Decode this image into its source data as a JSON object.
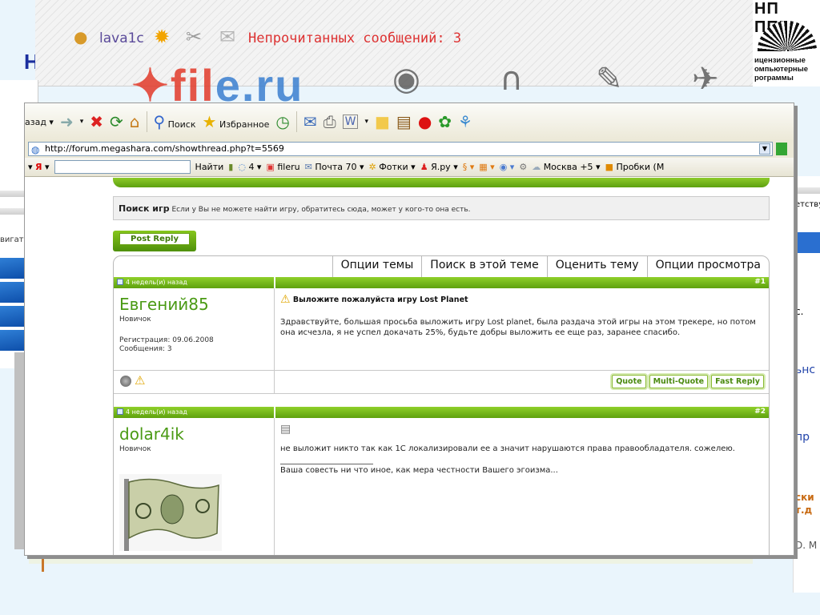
{
  "background": {
    "letter": "Н",
    "user_name": "lava1c",
    "unread_text": "Непрочитанных сообщений: 3",
    "right_logo": {
      "top_text": "НП ППП",
      "lines": [
        "ицензионные",
        "омпьютерные",
        "рограммы"
      ]
    },
    "left_strip_label": "вигато",
    "right_panel": [
      "етству",
      "с.",
      "ьнс",
      "пр",
      "ски",
      "т.д",
      "D. M"
    ]
  },
  "browser": {
    "toolbar": {
      "back_label": "азад",
      "search_label": "Поиск",
      "favorites_label": "Избранное"
    },
    "address": "http://forum.megashara.com/showthread.php?t=5569",
    "yandex_bar": {
      "logo": "Я",
      "find_label": "Найти",
      "messages": "4",
      "items": [
        "fileru",
        "Почта 70",
        "Фотки",
        "Я.ру",
        "Москва +5",
        "Пробки (М"
      ]
    }
  },
  "forum": {
    "info_title": "Поиск игр",
    "info_text": "Если у Вы не можете найти игру, обратитесь сюда, может у кого-то она есть.",
    "post_reply_label": "Post Reply",
    "thread_tools": [
      "Опции темы",
      "Поиск в этой теме",
      "Оценить тему",
      "Опции просмотра"
    ],
    "posts": [
      {
        "date": "4 недель(и) назад",
        "number": "#1",
        "user": "Евгений85",
        "user_title": "Новичок",
        "registered": "Регистрация: 09.06.2008",
        "messages": "Сообщения: 3",
        "title": "Выложите пожалуйста игру Lost Planet",
        "text": "Здравствуйте, большая просьба выложить игру Lost planet, была раздача этой игры на этом трекере, но потом она исчезла, я не успел докачать 25%, будьте добры выложить ее еще раз, заранее спасибо.",
        "buttons": [
          "Quote",
          "Multi-Quote",
          "Fast Reply"
        ]
      },
      {
        "date": "4 недель(и) назад",
        "number": "#2",
        "user": "dolar4ik",
        "user_title": "Новичок",
        "text": "не выложит никто так как 1С локализировали ее а значит нарушаются права правообладателя. сожелею.",
        "signature": "Ваша совесть ни что иное, как мера честности Вашего эгоизма..."
      }
    ]
  }
}
